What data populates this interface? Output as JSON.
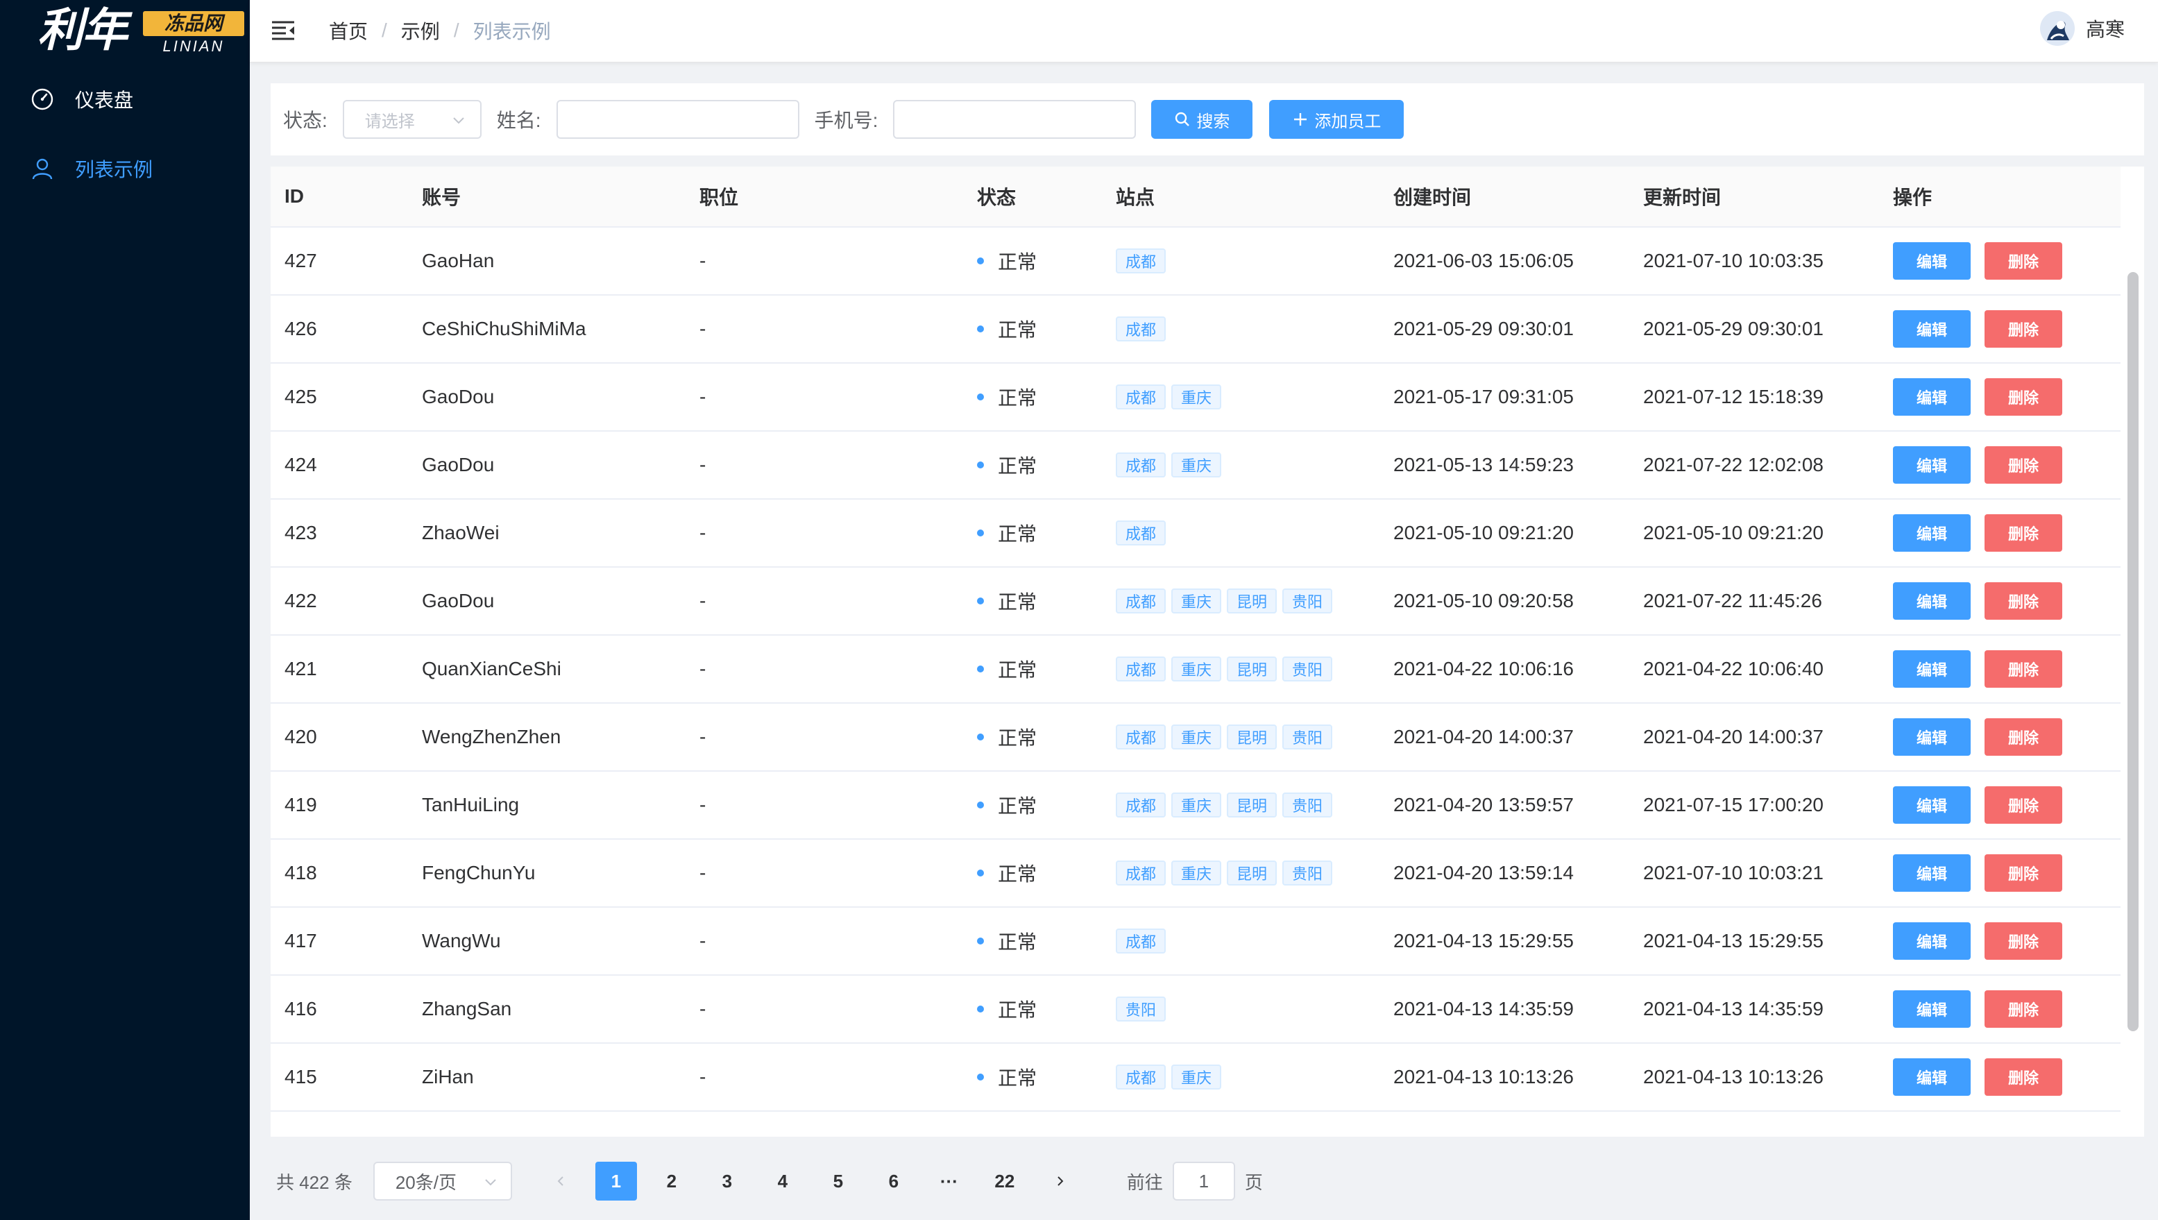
{
  "logo": {
    "main": "利年",
    "box": "冻品网",
    "sub": "LINIAN"
  },
  "sidebar": {
    "items": [
      {
        "label": "仪表盘",
        "icon": "dashboard-icon",
        "active": false
      },
      {
        "label": "列表示例",
        "icon": "user-icon",
        "active": true
      }
    ]
  },
  "header": {
    "breadcrumb": [
      "首页",
      "示例",
      "列表示例"
    ],
    "separator": "/",
    "user_name": "高寒"
  },
  "filter": {
    "status_label": "状态:",
    "status_placeholder": "请选择",
    "name_label": "姓名:",
    "phone_label": "手机号:",
    "search_label": "搜索",
    "add_label": "添加员工"
  },
  "table": {
    "columns": [
      "ID",
      "账号",
      "职位",
      "状态",
      "站点",
      "创建时间",
      "更新时间",
      "操作"
    ],
    "edit_label": "编辑",
    "delete_label": "删除",
    "rows": [
      {
        "id": "427",
        "account": "GaoHan",
        "position": "-",
        "status": "正常",
        "sites": [
          "成都"
        ],
        "created": "2021-06-03 15:06:05",
        "updated": "2021-07-10 10:03:35"
      },
      {
        "id": "426",
        "account": "CeShiChuShiMiMa",
        "position": "-",
        "status": "正常",
        "sites": [
          "成都"
        ],
        "created": "2021-05-29 09:30:01",
        "updated": "2021-05-29 09:30:01"
      },
      {
        "id": "425",
        "account": "GaoDou",
        "position": "-",
        "status": "正常",
        "sites": [
          "成都",
          "重庆"
        ],
        "created": "2021-05-17 09:31:05",
        "updated": "2021-07-12 15:18:39"
      },
      {
        "id": "424",
        "account": "GaoDou",
        "position": "-",
        "status": "正常",
        "sites": [
          "成都",
          "重庆"
        ],
        "created": "2021-05-13 14:59:23",
        "updated": "2021-07-22 12:02:08"
      },
      {
        "id": "423",
        "account": "ZhaoWei",
        "position": "-",
        "status": "正常",
        "sites": [
          "成都"
        ],
        "created": "2021-05-10 09:21:20",
        "updated": "2021-05-10 09:21:20"
      },
      {
        "id": "422",
        "account": "GaoDou",
        "position": "-",
        "status": "正常",
        "sites": [
          "成都",
          "重庆",
          "昆明",
          "贵阳"
        ],
        "created": "2021-05-10 09:20:58",
        "updated": "2021-07-22 11:45:26"
      },
      {
        "id": "421",
        "account": "QuanXianCeShi",
        "position": "-",
        "status": "正常",
        "sites": [
          "成都",
          "重庆",
          "昆明",
          "贵阳"
        ],
        "created": "2021-04-22 10:06:16",
        "updated": "2021-04-22 10:06:40"
      },
      {
        "id": "420",
        "account": "WengZhenZhen",
        "position": "-",
        "status": "正常",
        "sites": [
          "成都",
          "重庆",
          "昆明",
          "贵阳"
        ],
        "created": "2021-04-20 14:00:37",
        "updated": "2021-04-20 14:00:37"
      },
      {
        "id": "419",
        "account": "TanHuiLing",
        "position": "-",
        "status": "正常",
        "sites": [
          "成都",
          "重庆",
          "昆明",
          "贵阳"
        ],
        "created": "2021-04-20 13:59:57",
        "updated": "2021-07-15 17:00:20"
      },
      {
        "id": "418",
        "account": "FengChunYu",
        "position": "-",
        "status": "正常",
        "sites": [
          "成都",
          "重庆",
          "昆明",
          "贵阳"
        ],
        "created": "2021-04-20 13:59:14",
        "updated": "2021-07-10 10:03:21"
      },
      {
        "id": "417",
        "account": "WangWu",
        "position": "-",
        "status": "正常",
        "sites": [
          "成都"
        ],
        "created": "2021-04-13 15:29:55",
        "updated": "2021-04-13 15:29:55"
      },
      {
        "id": "416",
        "account": "ZhangSan",
        "position": "-",
        "status": "正常",
        "sites": [
          "贵阳"
        ],
        "created": "2021-04-13 14:35:59",
        "updated": "2021-04-13 14:35:59"
      },
      {
        "id": "415",
        "account": "ZiHan",
        "position": "-",
        "status": "正常",
        "sites": [
          "成都",
          "重庆"
        ],
        "created": "2021-04-13 10:13:26",
        "updated": "2021-04-13 10:13:26"
      }
    ]
  },
  "pagination": {
    "total_text": "共 422 条",
    "page_size": "20条/页",
    "pages": [
      "1",
      "2",
      "3",
      "4",
      "5",
      "6",
      "···",
      "22"
    ],
    "current": "1",
    "goto_label": "前往",
    "goto_value": "1",
    "page_suffix": "页"
  },
  "colors": {
    "sidebar_bg": "#001529",
    "primary": "#409eff",
    "danger": "#f56c6c",
    "logo_accent": "#f2b53a"
  }
}
